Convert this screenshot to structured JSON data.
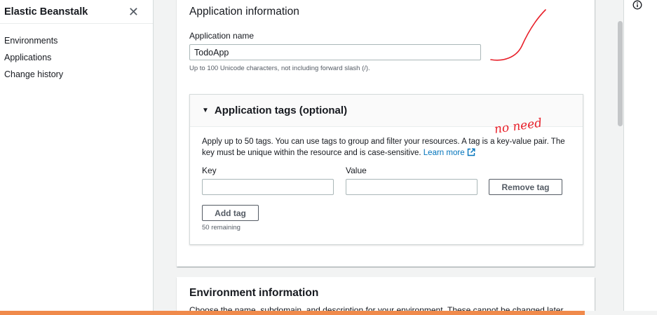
{
  "sidebar": {
    "title": "Elastic Beanstalk",
    "close_glyph": "✕",
    "items": [
      {
        "label": "Environments"
      },
      {
        "label": "Applications"
      },
      {
        "label": "Change history"
      }
    ]
  },
  "app_info": {
    "title": "Application information",
    "name_label": "Application name",
    "name_value": "TodoApp",
    "name_hint": "Up to 100 Unicode characters, not including forward slash (/)."
  },
  "tags": {
    "caret": "▼",
    "title": "Application tags (optional)",
    "description": "Apply up to 50 tags. You can use tags to group and filter your resources. A tag is a key-value pair. The key must be unique within the resource and is case-sensitive.",
    "learn_more": "Learn more",
    "key_label": "Key",
    "value_label": "Value",
    "key_value": "",
    "value_value": "",
    "remove_button": "Remove tag",
    "add_button": "Add tag",
    "remaining": "50 remaining"
  },
  "env_info": {
    "title": "Environment information",
    "description": "Choose the name, subdomain, and description for your environment. These cannot be changed later."
  },
  "annotation": {
    "text": "no need"
  },
  "progress": {
    "percent": 89
  },
  "colors": {
    "link": "#0073bb",
    "annotation": "#e8202a",
    "progress": "#f08a4b"
  },
  "icons": {
    "close": "close-icon",
    "caret": "caret-down-icon",
    "external": "external-link-icon",
    "info": "info-icon"
  }
}
